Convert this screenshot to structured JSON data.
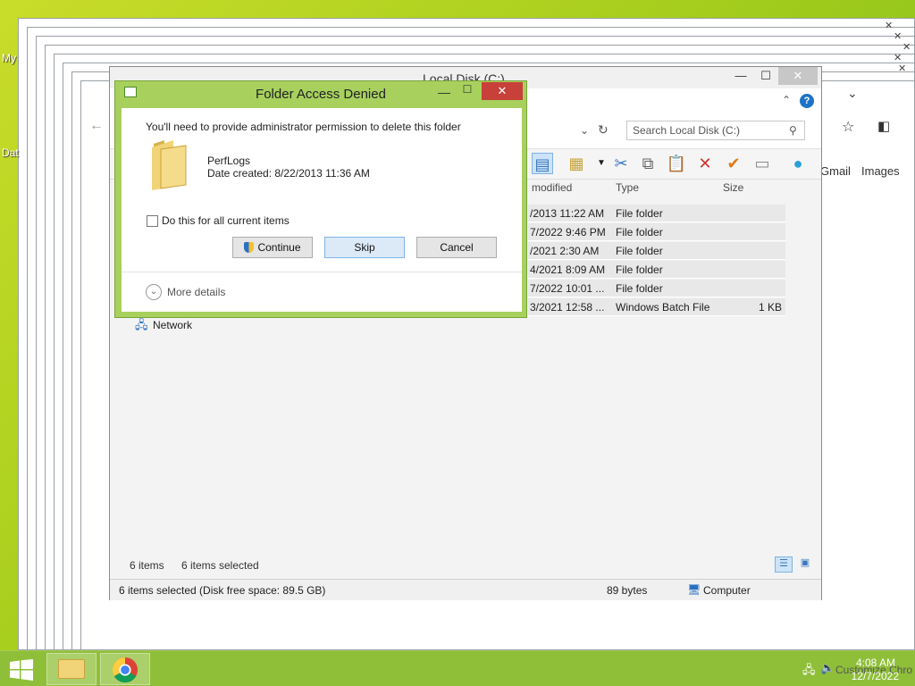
{
  "desktop": {
    "icon_labels": [
      "My",
      "Dat"
    ]
  },
  "explorer": {
    "title": "Local Disk (C:)",
    "search_placeholder": "Search Local Disk (C:)",
    "columns": [
      "modified",
      "Type",
      "Size"
    ],
    "rows": [
      {
        "date": "/2013 11:22 AM",
        "type": "File folder",
        "size": ""
      },
      {
        "date": "7/2022 9:46 PM",
        "type": "File folder",
        "size": ""
      },
      {
        "date": "/2021 2:30 AM",
        "type": "File folder",
        "size": ""
      },
      {
        "date": "4/2021 8:09 AM",
        "type": "File folder",
        "size": ""
      },
      {
        "date": "7/2022 10:01 ...",
        "type": "File folder",
        "size": ""
      },
      {
        "date": "3/2021 12:58 ...",
        "type": "Windows Batch File",
        "size": "1 KB"
      }
    ],
    "nav_network": "Network",
    "items_count": "6 items",
    "items_selected": "6 items selected",
    "status_left": "6 items selected (Disk free space: 89.5 GB)",
    "status_size": "89 bytes",
    "status_location": "Computer"
  },
  "chrome": {
    "gmail": "Gmail",
    "images": "Images"
  },
  "dialog": {
    "title": "Folder Access Denied",
    "message": "You'll need to provide administrator permission to delete this folder",
    "folder_name": "PerfLogs",
    "folder_date": "Date created: 8/22/2013 11:36 AM",
    "checkbox_label": "Do this for all current items",
    "checkbox_checked": false,
    "continue_label": "Continue",
    "skip_label": "Skip",
    "cancel_label": "Cancel",
    "more_details": "More details"
  },
  "taskbar": {
    "time": "4:08 AM",
    "date": "12/7/2022",
    "tray_text": "Customize Chro"
  }
}
